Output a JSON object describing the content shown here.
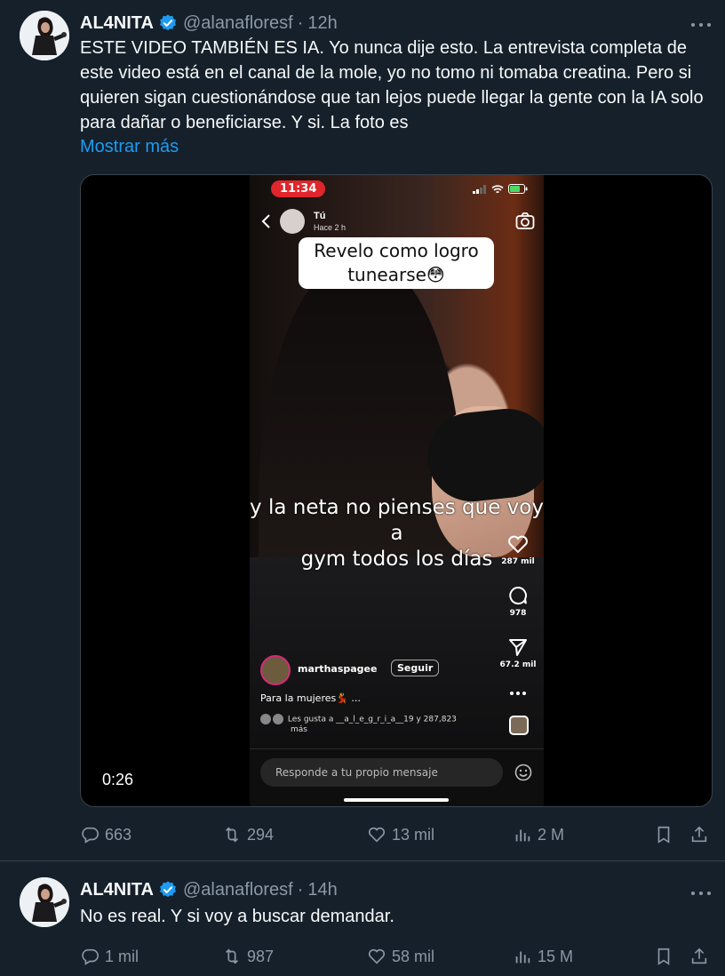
{
  "tweets": [
    {
      "author": "AL4NITA",
      "handle": "@alanafloresf",
      "time": "12h",
      "text": "ESTE VIDEO TAMBIÉN ES IA. Yo nunca dije esto. La entrevista completa de este video está en el canal de la mole, yo no tomo ni tomaba creatina. Pero si quieren sigan cuestionándose que tan lejos puede llegar la gente con la IA solo para dañar o beneficiarse. Y si. La foto es",
      "show_more": "Mostrar más",
      "video": {
        "duration": "0:26",
        "status_time": "11:34",
        "story_user": "Tú",
        "story_age": "Hace 2 h",
        "caption_line1": "Revelo como logro",
        "caption_line2": "tunearse😳",
        "subtitle_line1": "y la neta no pienses que voy a",
        "subtitle_line2": "gym todos los días",
        "likes_count": "287 mil",
        "comments_count": "978",
        "shares_count": "67.2 mil",
        "reel_user": "marthaspagee",
        "follow_label": "Seguir",
        "reel_caption": "Para la mujeres💃 ...",
        "liked_by_line1": "Les gusta a __a_l_e_g_r_i_a__19 y 287,823",
        "liked_by_line2": "más",
        "reply_placeholder": "Responde a tu propio mensaje"
      },
      "replies": "663",
      "reposts": "294",
      "likes": "13 mil",
      "views": "2 M"
    },
    {
      "author": "AL4NITA",
      "handle": "@alanafloresf",
      "time": "14h",
      "text": "No es real. Y si voy a buscar demandar.",
      "replies": "1 mil",
      "reposts": "987",
      "likes": "58 mil",
      "views": "15 M"
    }
  ],
  "colors": {
    "background": "#15202b",
    "text": "#f7f9f9",
    "muted": "#8b98a5",
    "link": "#1d9bf0",
    "verified": "#1d9bf0",
    "divider": "#38444d"
  },
  "icons": [
    "verified-badge-icon",
    "more-icon",
    "reply-icon",
    "repost-icon",
    "like-icon",
    "views-icon",
    "bookmark-icon",
    "share-icon",
    "camera-icon",
    "back-chevron-icon",
    "heart-icon",
    "comment-icon",
    "send-icon",
    "sticker-icon"
  ]
}
